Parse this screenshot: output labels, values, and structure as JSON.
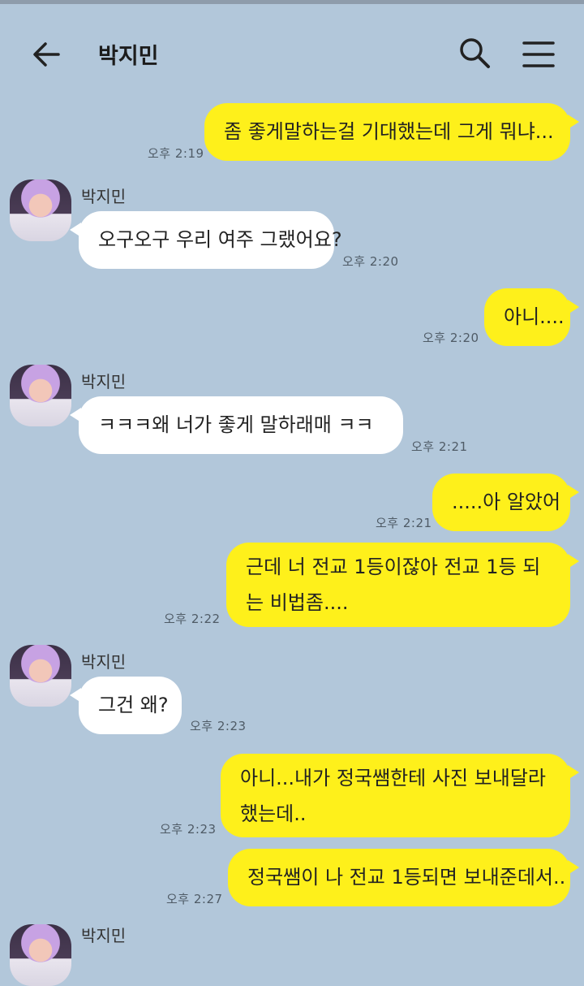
{
  "header": {
    "title": "박지민",
    "back_icon": "arrow-left-icon",
    "search_icon": "search-icon",
    "menu_icon": "hamburger-menu-icon"
  },
  "colors": {
    "background": "#b2c7da",
    "outgoing_bubble": "#fef01b",
    "incoming_bubble": "#ffffff"
  },
  "messages": [
    {
      "from": "me",
      "text": "좀 좋게말하는걸 기대했는데 그게 뭐냐...",
      "time": "오후 2:19"
    },
    {
      "from": "박지민",
      "sender_label": "박지민",
      "text": "오구오구 우리 여주 그랬어요?",
      "time": "오후 2:20"
    },
    {
      "from": "me",
      "text": "아니....",
      "time": "오후 2:20"
    },
    {
      "from": "박지민",
      "sender_label": "박지민",
      "text": "ㅋㅋㅋ왜 너가 좋게 말하래매 ㅋㅋ",
      "time": "오후 2:21"
    },
    {
      "from": "me",
      "text": ".....아 알았어",
      "time": "오후 2:21"
    },
    {
      "from": "me",
      "text": "근데 너 전교 1등이잖아 전교 1등 되는 비법좀....",
      "time": "오후 2:22"
    },
    {
      "from": "박지민",
      "sender_label": "박지민",
      "text": "그건 왜?",
      "time": "오후 2:23"
    },
    {
      "from": "me",
      "text": "아니...내가 정국쌤한테 사진 보내달라 했는데..",
      "time": "오후 2:23"
    },
    {
      "from": "me",
      "text": "정국쌤이 나 전교 1등되면 보내준데서..",
      "time": "오후 2:27"
    },
    {
      "from": "박지민",
      "sender_label": "박지민"
    }
  ]
}
